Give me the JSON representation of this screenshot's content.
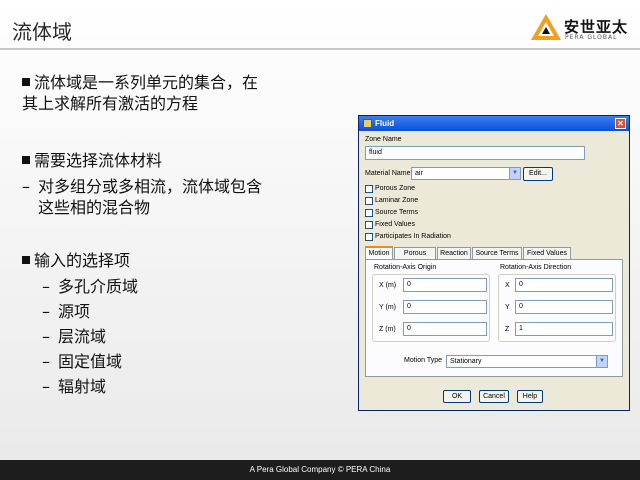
{
  "slide": {
    "title": "流体域",
    "logo": {
      "text": "安世亚太",
      "subtext": "PERA GLOBAL"
    },
    "bullet1": {
      "line1": "流体域是一系列单元的集合，在",
      "line2": "其上求解所有激活的方程"
    },
    "bullet2": {
      "text": "需要选择流体材料",
      "sub_line1": "对多组分或多相流，流体域包含",
      "sub_line2": "这些相的混合物"
    },
    "bullet3": {
      "text": "输入的选择项",
      "subs": [
        "多孔介质域",
        "源项",
        "层流域",
        "固定值域",
        "辐射域"
      ]
    },
    "footer": "A Pera Global Company ©  PERA China"
  },
  "dialog": {
    "title": "Fluid",
    "zone_name_label": "Zone Name",
    "zone_name_value": "fluid",
    "material_label": "Material Name",
    "material_value": "air",
    "edit_button": "Edit...",
    "checkboxes": [
      "Porous Zone",
      "Laminar Zone",
      "Source Terms",
      "Fixed Values",
      "Participates In Radiation"
    ],
    "tabs": [
      "Motion",
      "Porous Zone",
      "Reaction",
      "Source Terms",
      "Fixed Values"
    ],
    "active_tab": "Motion",
    "origin_title": "Rotation-Axis Origin",
    "direction_title": "Rotation-Axis Direction",
    "origin": [
      {
        "label": "X (m)",
        "value": "0"
      },
      {
        "label": "Y (m)",
        "value": "0"
      },
      {
        "label": "Z (m)",
        "value": "0"
      }
    ],
    "direction": [
      {
        "label": "X",
        "value": "0"
      },
      {
        "label": "Y",
        "value": "0"
      },
      {
        "label": "Z",
        "value": "1"
      }
    ],
    "motion_type_label": "Motion Type",
    "motion_type_value": "Stationary",
    "buttons": {
      "ok": "OK",
      "cancel": "Cancel",
      "help": "Help"
    }
  }
}
